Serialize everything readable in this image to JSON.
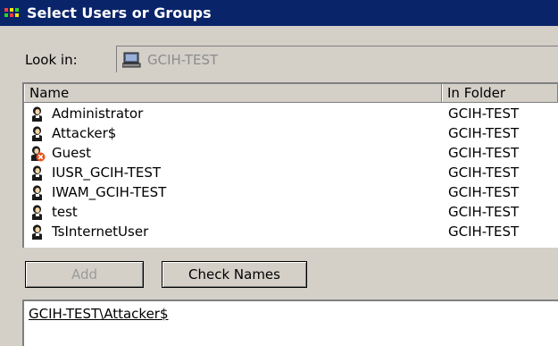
{
  "window": {
    "title": "Select Users or Groups"
  },
  "look_in": {
    "label": "Look in:",
    "value": "GCIH-TEST"
  },
  "list": {
    "columns": [
      "Name",
      "In Folder"
    ],
    "rows": [
      {
        "name": "Administrator",
        "folder": "GCIH-TEST",
        "icon": "user-icon"
      },
      {
        "name": "Attacker$",
        "folder": "GCIH-TEST",
        "icon": "user-icon"
      },
      {
        "name": "Guest",
        "folder": "GCIH-TEST",
        "icon": "disabled-user-icon"
      },
      {
        "name": "IUSR_GCIH-TEST",
        "folder": "GCIH-TEST",
        "icon": "user-icon"
      },
      {
        "name": "IWAM_GCIH-TEST",
        "folder": "GCIH-TEST",
        "icon": "user-icon"
      },
      {
        "name": "test",
        "folder": "GCIH-TEST",
        "icon": "user-icon"
      },
      {
        "name": "TsInternetUser",
        "folder": "GCIH-TEST",
        "icon": "user-icon"
      }
    ]
  },
  "buttons": {
    "add": "Add",
    "check_names": "Check Names"
  },
  "selected_names": {
    "value": "GCIH-TEST\\Attacker$"
  }
}
